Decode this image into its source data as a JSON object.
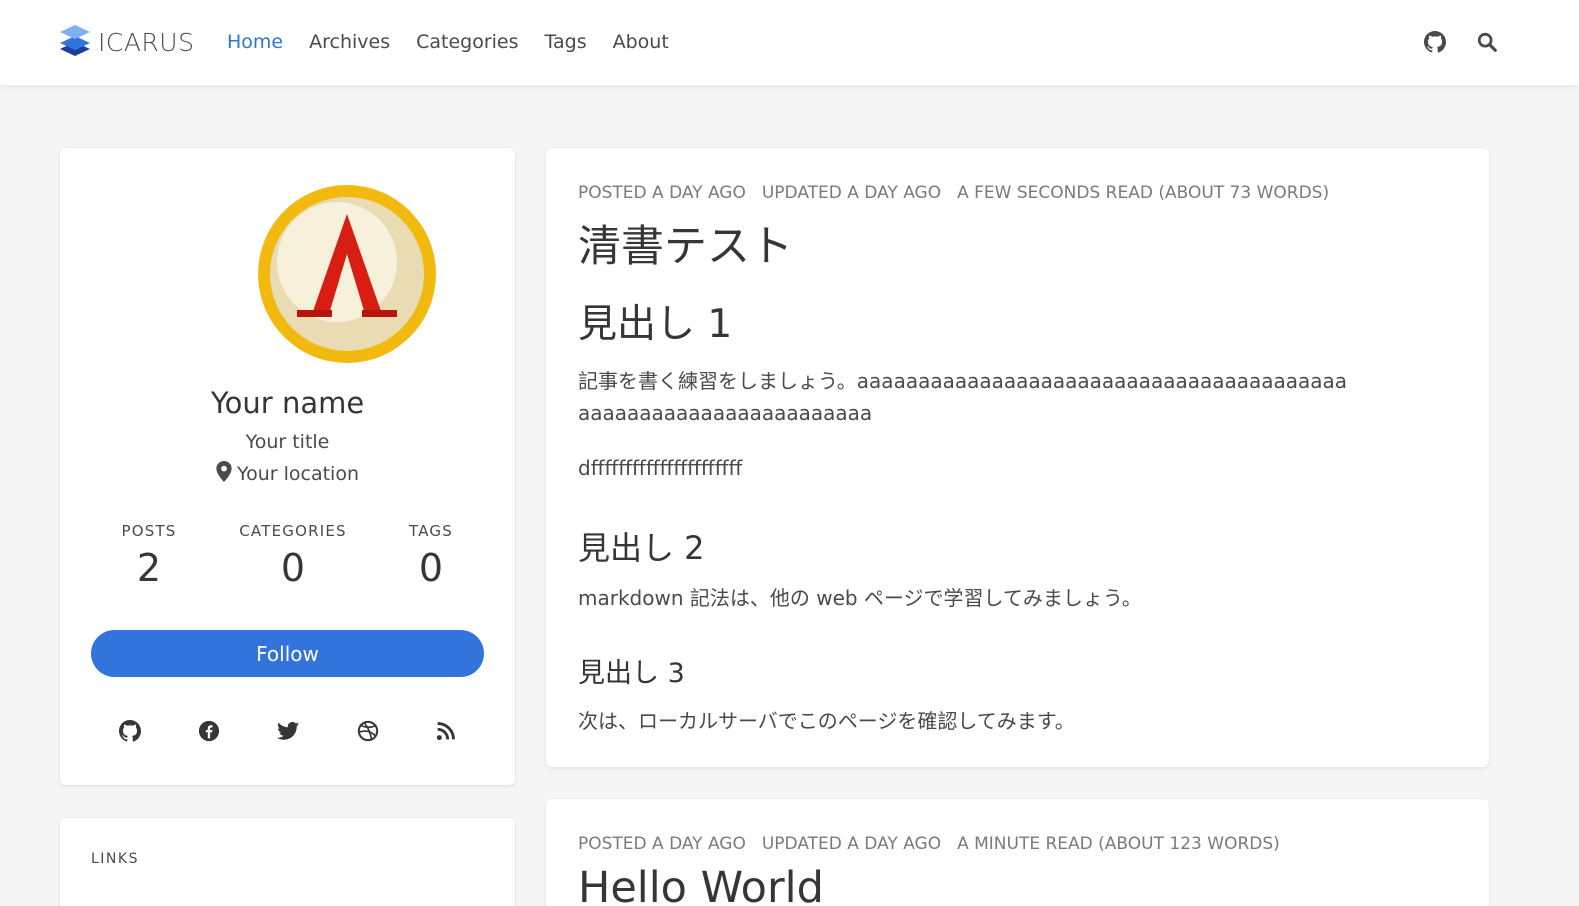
{
  "brand": {
    "name": "ICARUS",
    "logo_icon": "layers-logo-icon"
  },
  "nav": {
    "links": [
      {
        "label": "Home",
        "active": true
      },
      {
        "label": "Archives",
        "active": false
      },
      {
        "label": "Categories",
        "active": false
      },
      {
        "label": "Tags",
        "active": false
      },
      {
        "label": "About",
        "active": false
      }
    ],
    "right_icons": [
      "github-icon",
      "search-icon"
    ]
  },
  "profile": {
    "name": "Your name",
    "title": "Your title",
    "location": "Your location",
    "stats": [
      {
        "label": "POSTS",
        "value": "2"
      },
      {
        "label": "CATEGORIES",
        "value": "0"
      },
      {
        "label": "TAGS",
        "value": "0"
      }
    ],
    "follow_label": "Follow",
    "socials": [
      "github-icon",
      "facebook-icon",
      "twitter-icon",
      "dribbble-icon",
      "rss-icon"
    ]
  },
  "links_widget": {
    "title": "LINKS"
  },
  "posts": [
    {
      "posted": "POSTED A DAY AGO",
      "updated": "UPDATED A DAY AGO",
      "read": "A FEW SECONDS READ (ABOUT 73 WORDS)",
      "title": "清書テスト",
      "heading1": "見出し 1",
      "para1_line1": "記事を書く練習をしましょう。aaaaaaaaaaaaaaaaaaaaaaaaaaaaaaaaaaaaaaaa",
      "para1_line2": "aaaaaaaaaaaaaaaaaaaaaaaa",
      "para2": "dffffffffffffffffffffff",
      "heading2": "見出し 2",
      "para3": "markdown 記法は、他の web ページで学習してみましょう。",
      "heading3": "見出し 3",
      "para4": "次は、ローカルサーバでこのページを確認してみます。"
    },
    {
      "posted": "POSTED A DAY AGO",
      "updated": "UPDATED A DAY AGO",
      "read": "A MINUTE READ (ABOUT 123 WORDS)",
      "title": "Hello World"
    }
  ],
  "colors": {
    "accent": "#3273dc",
    "background": "#f5f5f5",
    "text": "#363636",
    "meta": "#7a7a7a"
  }
}
